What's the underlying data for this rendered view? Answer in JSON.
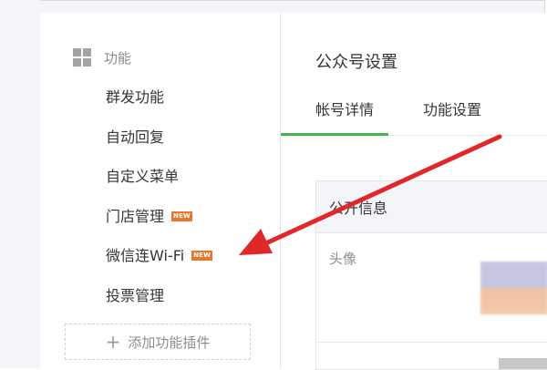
{
  "sidebar": {
    "section_title": "功能",
    "section_icon": "grid-icon",
    "items": [
      {
        "label": "群发功能",
        "badge": ""
      },
      {
        "label": "自动回复",
        "badge": ""
      },
      {
        "label": "自定义菜单",
        "badge": ""
      },
      {
        "label": "门店管理",
        "badge": "NEW"
      },
      {
        "label": "微信连Wi-Fi",
        "badge": "NEW"
      },
      {
        "label": "投票管理",
        "badge": ""
      }
    ],
    "add_plugin_label": "添加功能插件",
    "add_plugin_icon": "plus-icon"
  },
  "main": {
    "title": "公众号设置",
    "tabs": [
      {
        "label": "帐号详情",
        "active": true
      },
      {
        "label": "功能设置",
        "active": false
      }
    ],
    "panel": {
      "header": "公开信息",
      "avatar_label": "头像"
    }
  },
  "colors": {
    "accent_green": "#44b549",
    "badge_orange": "#e8762d",
    "annotation_arrow": "#e0282b",
    "page_bg": "#f4f5f9"
  }
}
